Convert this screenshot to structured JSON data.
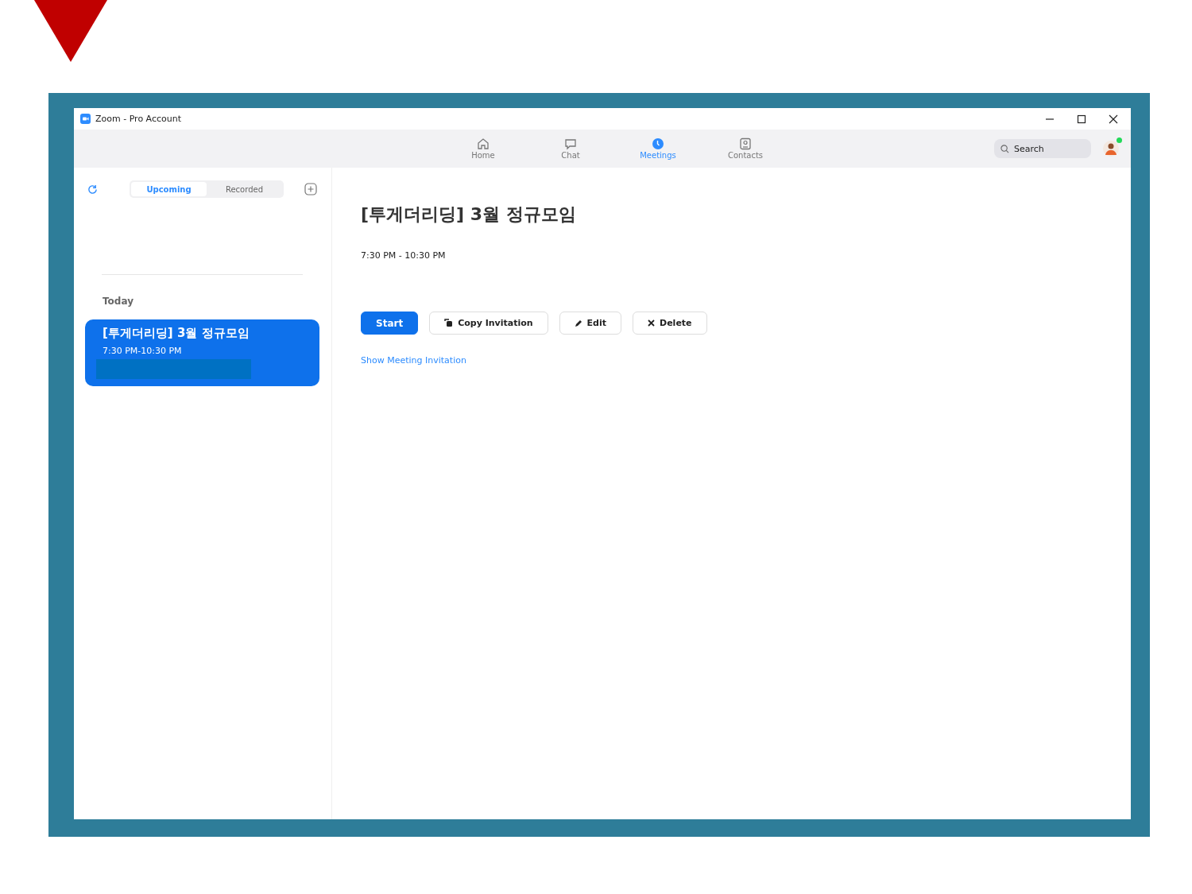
{
  "window": {
    "title": "Zoom - Pro Account"
  },
  "nav": [
    {
      "label": "Home",
      "kind": "home",
      "selected": false
    },
    {
      "label": "Chat",
      "kind": "chat",
      "selected": false
    },
    {
      "label": "Meetings",
      "kind": "meetings",
      "selected": true
    },
    {
      "label": "Contacts",
      "kind": "contacts",
      "selected": false
    }
  ],
  "search": {
    "placeholder": "Search"
  },
  "user": {
    "online": true
  },
  "sidebar": {
    "tabs": [
      {
        "label": "Upcoming",
        "selected": true
      },
      {
        "label": "Recorded",
        "selected": false
      }
    ],
    "section": "Today",
    "meetings": [
      {
        "title": "[투게더리딩] 3월 정규모임",
        "time": "7:30 PM-10:30 PM",
        "selected": true,
        "redacted": true
      }
    ]
  },
  "detail": {
    "title": "[투게더리딩] 3월 정규모임",
    "time": "7:30 PM - 10:30 PM",
    "buttons": [
      {
        "label": "Start",
        "kind": "primary"
      },
      {
        "label": "Copy Invitation",
        "kind": "copy"
      },
      {
        "label": "Edit",
        "kind": "edit"
      },
      {
        "label": "Delete",
        "kind": "delete"
      }
    ],
    "link": "Show Meeting Invitation"
  }
}
